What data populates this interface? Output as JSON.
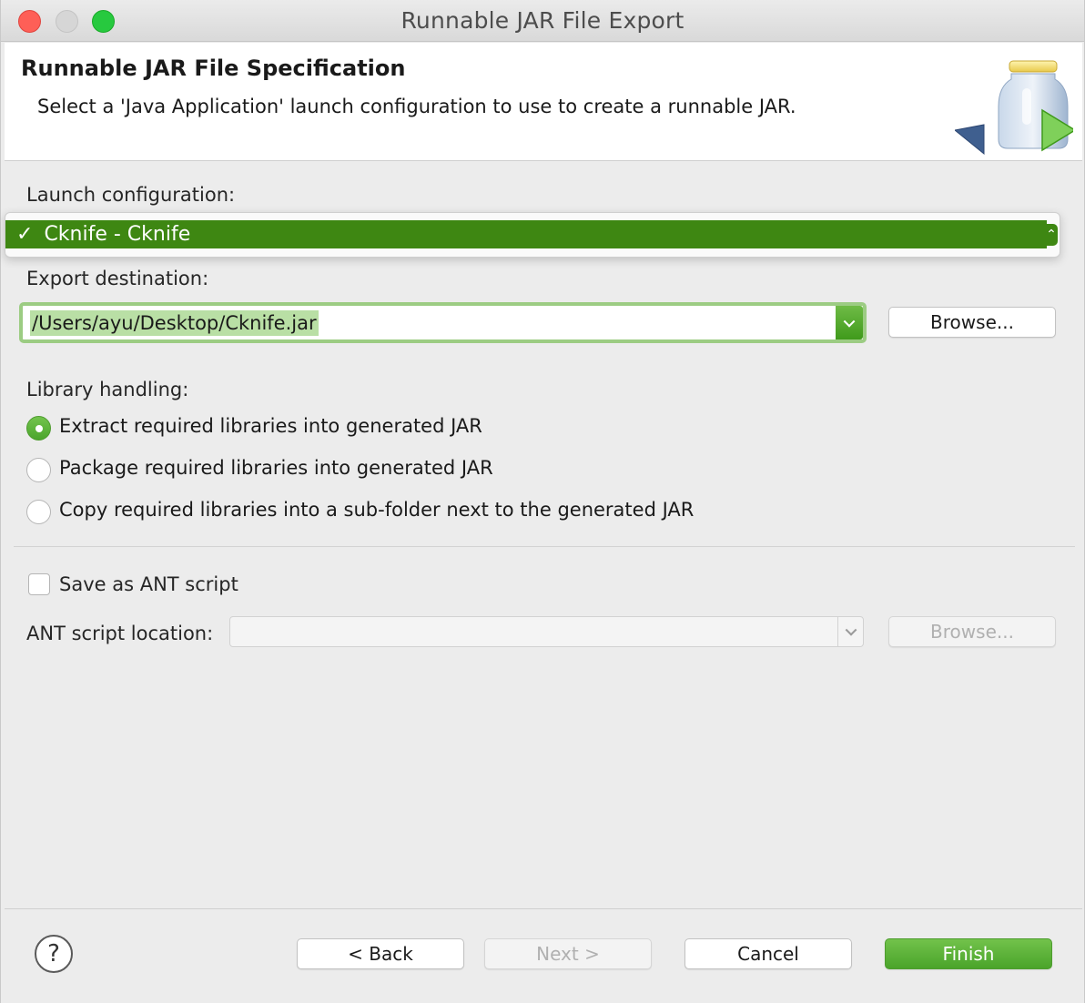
{
  "window": {
    "title": "Runnable JAR File Export"
  },
  "banner": {
    "title": "Runnable JAR File Specification",
    "description": "Select a 'Java Application' launch configuration to use to create a runnable JAR."
  },
  "launch": {
    "label": "Launch configuration:",
    "selected": "Cknife - Cknife",
    "check": "✓"
  },
  "export": {
    "label": "Export destination:",
    "value": "/Users/ayu/Desktop/Cknife.jar",
    "browse": "Browse..."
  },
  "library": {
    "label": "Library handling:",
    "options": [
      {
        "label": "Extract required libraries into generated JAR",
        "checked": true
      },
      {
        "label": "Package required libraries into generated JAR",
        "checked": false
      },
      {
        "label": "Copy required libraries into a sub-folder next to the generated JAR",
        "checked": false
      }
    ]
  },
  "ant": {
    "checkbox_label": "Save as ANT script",
    "checked": false,
    "location_label": "ANT script location:",
    "location_value": "",
    "browse": "Browse..."
  },
  "footer": {
    "help": "?",
    "back": "< Back",
    "next": "Next >",
    "cancel": "Cancel",
    "finish": "Finish"
  },
  "colors": {
    "accent": "#3e8712",
    "selection": "#b9dfa5",
    "primary_button": "#5bb33a"
  }
}
